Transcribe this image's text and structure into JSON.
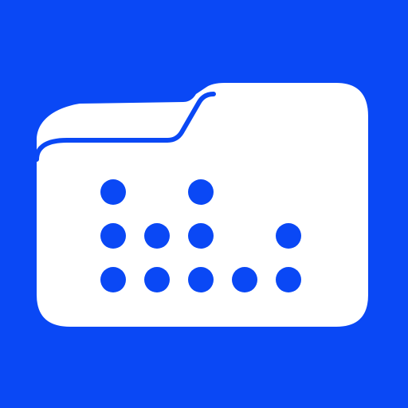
{
  "icon": {
    "name": "folder-dots-icon",
    "colors": {
      "background": "#0a48f5",
      "folder": "#ffffff",
      "dots": "#0a48f5"
    }
  }
}
